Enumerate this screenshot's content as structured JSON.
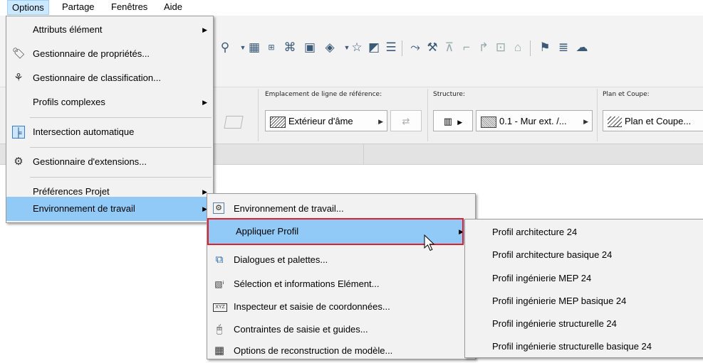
{
  "menubar": {
    "items": [
      {
        "label": "Options"
      },
      {
        "label": "Partage"
      },
      {
        "label": "Fenêtres"
      },
      {
        "label": "Aide"
      }
    ]
  },
  "infobox": {
    "ref_line_label": "Emplacement de ligne de référence:",
    "ref_line_value": "Extérieur d'âme",
    "structure_label": "Structure:",
    "structure_value": "0.1 - Mur ext. /...",
    "plan_label": "Plan et Coupe:",
    "plan_value": "Plan et Coupe..."
  },
  "options_menu": {
    "items": [
      {
        "label": "Attributs élément",
        "icon": "none",
        "submenu": true
      },
      {
        "label": "Gestionnaire de propriétés...",
        "icon": "tag-icon",
        "submenu": false
      },
      {
        "label": "Gestionnaire de classification...",
        "icon": "tree-icon",
        "submenu": false
      },
      {
        "label": "Profils complexes",
        "icon": "none",
        "submenu": true
      },
      {
        "label": "Intersection automatique",
        "icon": "intersection-icon",
        "submenu": false
      },
      {
        "label": "Gestionnaire d'extensions...",
        "icon": "addon-icon",
        "submenu": false
      },
      {
        "label": "Préférences Projet",
        "icon": "none",
        "submenu": true
      },
      {
        "label": "Environnement de travail",
        "icon": "none",
        "submenu": true,
        "highlighted": true
      }
    ]
  },
  "env_menu": {
    "items": [
      {
        "label": "Environnement de travail...",
        "icon": "workspace-icon"
      },
      {
        "label": "Appliquer Profil",
        "icon": "none",
        "submenu": true,
        "highlighted": true
      },
      {
        "label": "Dialogues et palettes...",
        "icon": "palettes-icon"
      },
      {
        "label": "Sélection et informations Elément...",
        "icon": "info-icon"
      },
      {
        "label": "Inspecteur et saisie de coordonnées...",
        "icon": "xyz-icon"
      },
      {
        "label": "Contraintes de saisie et guides...",
        "icon": "mouse-icon"
      },
      {
        "label": "Options de reconstruction de modèle...",
        "icon": "rebuild-icon"
      }
    ]
  },
  "profils_menu": {
    "items": [
      {
        "label": "Profil architecture 24"
      },
      {
        "label": "Profil architecture basique 24"
      },
      {
        "label": "Profil ingénierie MEP 24"
      },
      {
        "label": "Profil ingénierie MEP basique 24"
      },
      {
        "label": "Profil ingénierie structurelle 24"
      },
      {
        "label": "Profil ingénierie structurelle basique 24"
      }
    ]
  },
  "colors": {
    "menu_highlight": "#91c9f7",
    "callout_border": "#e3202a",
    "menu_bg": "#f2f2f2"
  }
}
